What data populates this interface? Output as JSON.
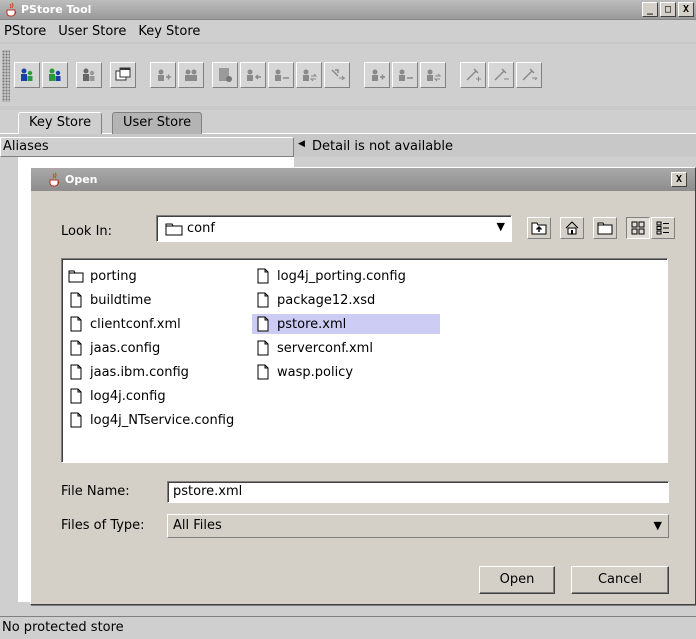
{
  "window": {
    "title": "PStore Tool",
    "min": "_",
    "max": "□",
    "close": "X"
  },
  "menu": [
    "PStore",
    "User Store",
    "Key Store"
  ],
  "toolbar": {
    "icons": [
      "users-blue-icon",
      "users-green-icon",
      "users-gray-icon",
      "window-icon",
      "add-user-icon",
      "user-keys-icon",
      "certificate-icon",
      "user-import-icon",
      "user-remove-icon",
      "user-sync-icon",
      "key-arrow-icon",
      "group-add-icon",
      "group-remove-icon",
      "group-sync-icon",
      "key-add-icon",
      "key-remove-icon",
      "key-sync-icon"
    ]
  },
  "tabs": [
    {
      "label": "Key Store",
      "active": true
    },
    {
      "label": "User Store",
      "active": false
    }
  ],
  "panel": {
    "aliases": "Aliases",
    "detail": "Detail is not available"
  },
  "status": "No protected store",
  "dialog": {
    "title": "Open",
    "close": "X",
    "look_in_label": "Look In:",
    "look_in_value": "conf",
    "files": [
      {
        "name": "porting",
        "type": "folder"
      },
      {
        "name": "buildtime",
        "type": "file"
      },
      {
        "name": "clientconf.xml",
        "type": "file"
      },
      {
        "name": "jaas.config",
        "type": "file"
      },
      {
        "name": "jaas.ibm.config",
        "type": "file"
      },
      {
        "name": "log4j.config",
        "type": "file"
      },
      {
        "name": "log4j_NTservice.config",
        "type": "file"
      },
      {
        "name": "log4j_porting.config",
        "type": "file"
      },
      {
        "name": "package12.xsd",
        "type": "file"
      },
      {
        "name": "pstore.xml",
        "type": "file",
        "selected": true
      },
      {
        "name": "serverconf.xml",
        "type": "file"
      },
      {
        "name": "wasp.policy",
        "type": "file"
      }
    ],
    "file_name_label": "File Name:",
    "file_name_value": "pstore.xml",
    "files_of_type_label": "Files of Type:",
    "files_of_type_value": "All Files",
    "open_button": "Open",
    "cancel_button": "Cancel"
  }
}
